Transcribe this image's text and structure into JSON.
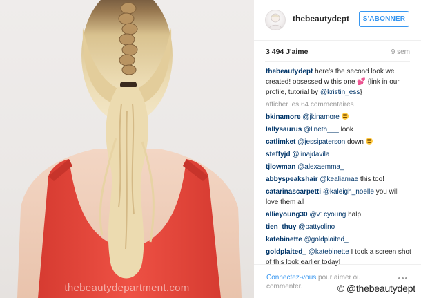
{
  "photo": {
    "alt_icon": "braided-ponytail-photo",
    "watermark": "thebeautydepartment.com"
  },
  "post_header": {
    "username": "thebeautydept",
    "follow_label": "S'ABONNER",
    "avatar_icon": "profile-avatar"
  },
  "stats": {
    "likes": "3 494 J'aime",
    "time": "9 sem"
  },
  "caption": {
    "username": "thebeautydept",
    "text_before": " here's the second look we created! obsessed w this one ",
    "emoji": "💕",
    "text_after": " {link in our profile, tutorial by ",
    "mention": "@kristin_ess",
    "end": "}"
  },
  "load_more": "afficher les 64 commentaires",
  "comments": [
    {
      "user": "bkinamore",
      "mention": "@jkinamore",
      "text": "",
      "emoji": "grinning-face"
    },
    {
      "user": "lallysaurus",
      "mention": "@lineth___",
      "text": " look",
      "emoji": ""
    },
    {
      "user": "catlimket",
      "mention": "@jessipaterson",
      "text": " down ",
      "emoji": "grinning-face"
    },
    {
      "user": "steffyjd",
      "mention": "@linajdavila",
      "text": "",
      "emoji": ""
    },
    {
      "user": "tjlowman",
      "mention": "@alexaemma_",
      "text": "",
      "emoji": ""
    },
    {
      "user": "abbyspeakshair",
      "mention": "@kealiamae",
      "text": " this too!",
      "emoji": ""
    },
    {
      "user": "catarinascarpetti",
      "mention": "@kaleigh_noelle",
      "text": " you will love them all",
      "emoji": ""
    },
    {
      "user": "allieyoung30",
      "mention": "@v1cyoung",
      "text": " halp",
      "emoji": ""
    },
    {
      "user": "tien_thuy",
      "mention": "@pattyolino",
      "text": "",
      "emoji": ""
    },
    {
      "user": "katebinette",
      "mention": "@goldplaited_",
      "text": "",
      "emoji": ""
    },
    {
      "user": "goldplaited_",
      "mention": "@katebinette",
      "text": " I took a screen shot of this look earlier today!",
      "emoji": ""
    }
  ],
  "footer": {
    "login_link": "Connectez-vous",
    "login_rest": " pour aimer ou commenter.",
    "more_icon": "more-options-icon"
  },
  "credit": {
    "symbol": "©",
    "text": "@thebeautydept"
  },
  "colors": {
    "accent": "#3897f0",
    "username": "#003569",
    "muted": "#999999",
    "text": "#262626",
    "shirt": "#e8453a"
  }
}
